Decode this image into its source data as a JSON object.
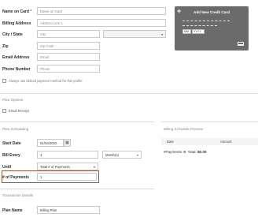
{
  "billing": {
    "name_on_card": {
      "label": "Name on Card",
      "required_mark": "*",
      "placeholder": "Name on Card"
    },
    "billing_address": {
      "label": "Billing Address",
      "placeholder": "Address Line 1"
    },
    "city_state": {
      "label": "City / State",
      "placeholder": "City"
    },
    "zip": {
      "label": "Zip",
      "placeholder": "Zip Code"
    },
    "email": {
      "label": "Email Address",
      "placeholder": "Email"
    },
    "phone": {
      "label": "Phone Number",
      "placeholder": "Phone"
    },
    "default_payment_text": "Always use default payment method for this profile"
  },
  "card": {
    "title": "Add New Credit Card",
    "month_placeholder": "MM",
    "year_placeholder": "YYYY",
    "plus_icon": "plus-icon",
    "chip_icon": "card-chip-icon"
  },
  "plan_options": {
    "title": "Plan Options",
    "email_receipt": "Email Receipt"
  },
  "plan_scheduling": {
    "title": "Plan Scheduling",
    "start_date": {
      "label": "Start Date",
      "value": "01/04/2022"
    },
    "bill_every": {
      "label": "Bill Every",
      "value": "1",
      "unit": "Month(s)"
    },
    "until": {
      "label": "Until",
      "value": "Total # of Payments"
    },
    "num_payments": {
      "label": "# of Payments",
      "value": "1"
    },
    "calendar_icon": "calendar-icon"
  },
  "preview": {
    "title": "Billing Schedule Preview",
    "col_date": "Date",
    "col_amount": "Amount",
    "payments_label": "#Payments:",
    "payments_value": "0",
    "total_label": "Total:",
    "total_value": "$0.00"
  },
  "transaction": {
    "title": "Transaction Details",
    "plan_name": {
      "label": "Plan Name",
      "value": "Billing Plan"
    }
  }
}
